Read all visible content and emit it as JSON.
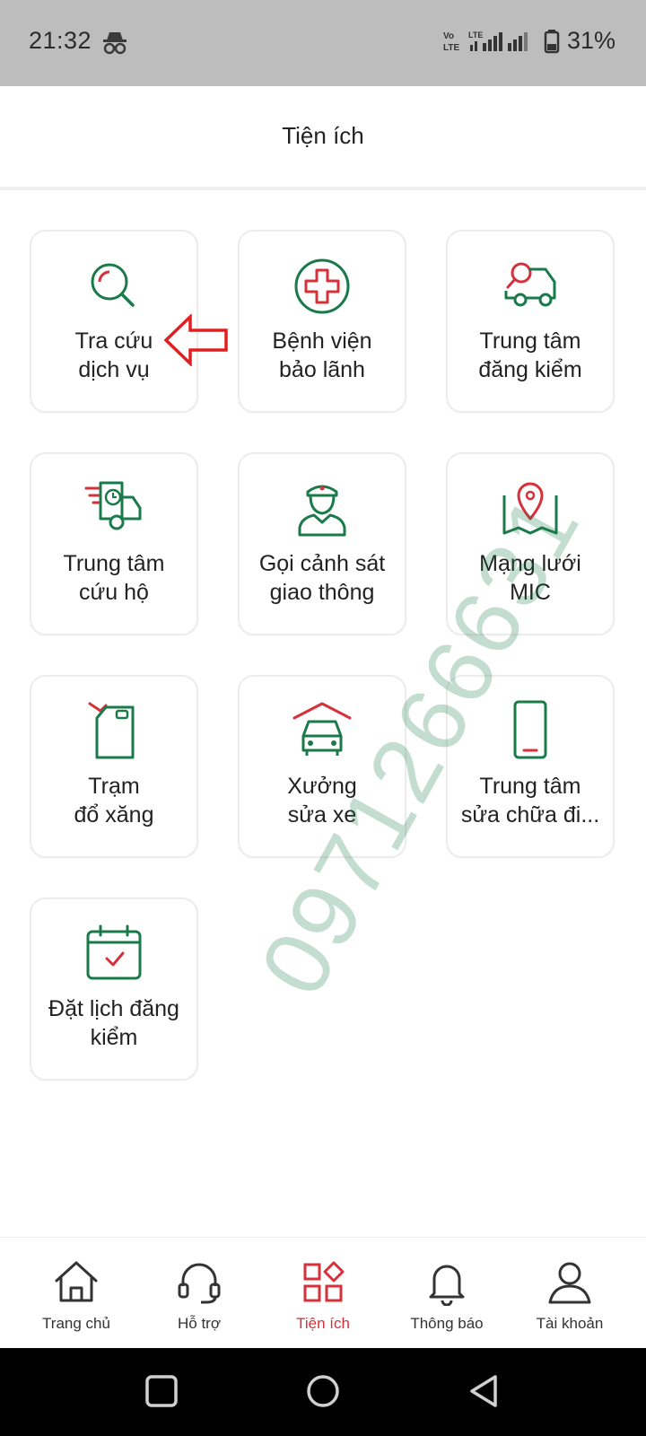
{
  "status_bar": {
    "time": "21:32",
    "incognito_icon": "incognito-icon",
    "volte_label": "Vo LTE",
    "lte_label": "LTE",
    "battery_percent": "31%"
  },
  "header": {
    "title": "Tiện ích"
  },
  "tiles": [
    {
      "label_1": "Tra cứu",
      "label_2": "dịch vụ",
      "icon": "search-icon"
    },
    {
      "label_1": "Bệnh viện",
      "label_2": "bảo lãnh",
      "icon": "hospital-cross-icon"
    },
    {
      "label_1": "Trung tâm",
      "label_2": "đăng kiểm",
      "icon": "inspection-truck-icon"
    },
    {
      "label_1": "Trung tâm",
      "label_2": "cứu hộ",
      "icon": "rescue-truck-icon"
    },
    {
      "label_1": "Gọi cảnh sát",
      "label_2": "giao thông",
      "icon": "traffic-police-icon"
    },
    {
      "label_1": "Mạng lưới",
      "label_2": "MIC",
      "icon": "map-pin-icon"
    },
    {
      "label_1": "Trạm",
      "label_2": "đổ xăng",
      "icon": "fuel-can-icon"
    },
    {
      "label_1": "Xưởng",
      "label_2": "sửa xe",
      "icon": "garage-car-icon"
    },
    {
      "label_1": "Trung tâm",
      "label_2": "sửa chữa đi...",
      "icon": "phone-repair-icon"
    },
    {
      "label_1": "Đặt lịch đăng",
      "label_2": "kiểm",
      "icon": "calendar-check-icon"
    }
  ],
  "watermark": "0971266631",
  "bottom_nav": [
    {
      "label": "Trang chủ",
      "icon": "home-icon",
      "active": false
    },
    {
      "label": "Hỗ trợ",
      "icon": "headset-icon",
      "active": false
    },
    {
      "label": "Tiện ích",
      "icon": "utilities-grid-icon",
      "active": true
    },
    {
      "label": "Thông báo",
      "icon": "bell-icon",
      "active": false
    },
    {
      "label": "Tài khoản",
      "icon": "user-icon",
      "active": false
    }
  ],
  "colors": {
    "accent_green": "#1a7a4a",
    "accent_red": "#d6313a",
    "status_bar_bg": "#bdbdbd"
  }
}
